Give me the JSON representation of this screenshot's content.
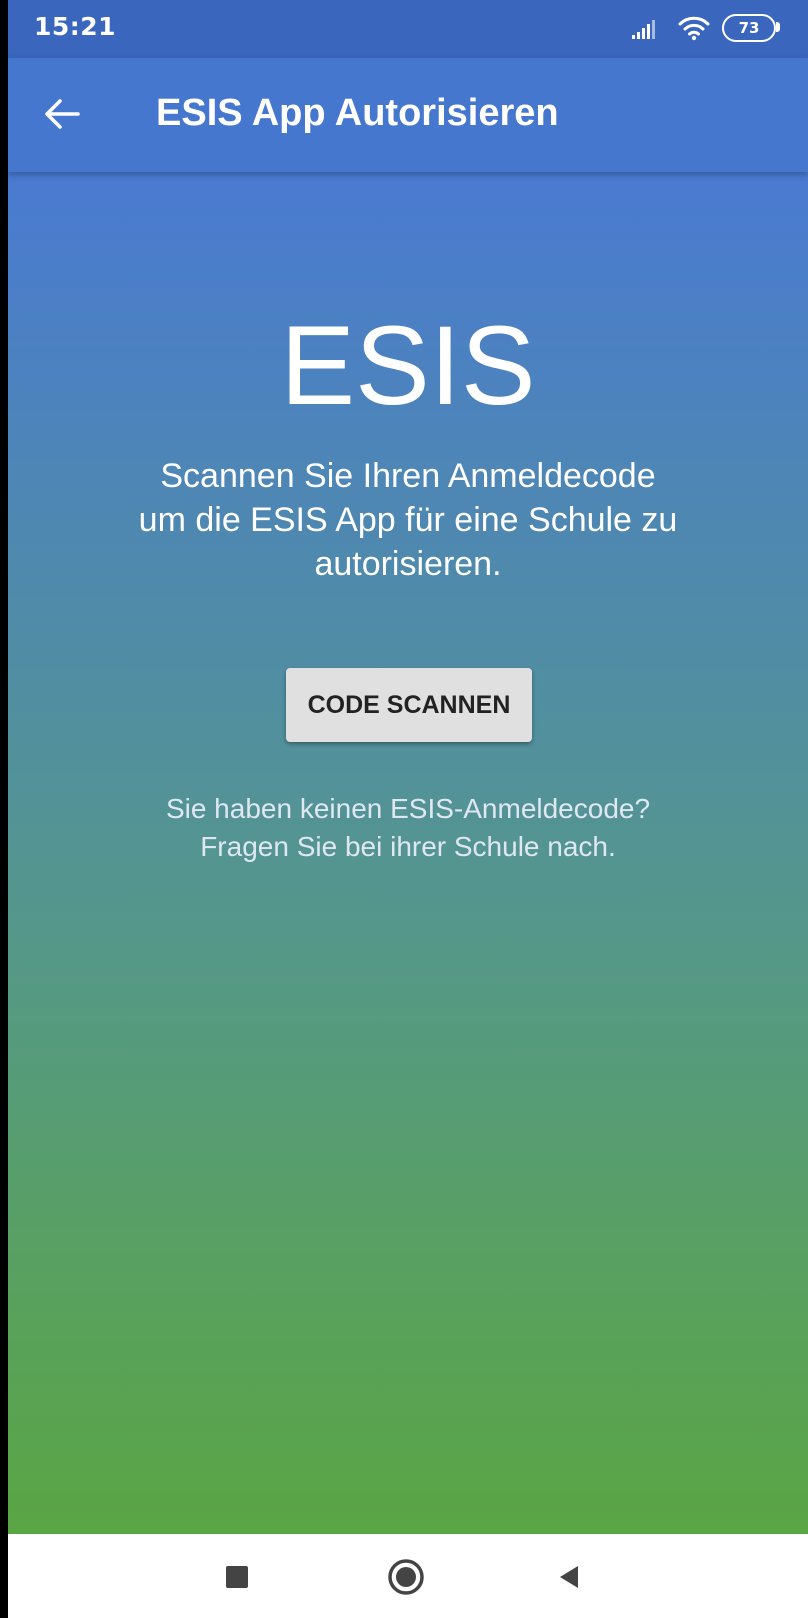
{
  "status_bar": {
    "time": "15:21",
    "battery_level": "73",
    "icons": [
      "signal-icon",
      "wifi-icon",
      "battery-icon"
    ]
  },
  "app_bar": {
    "title": "ESIS App Autorisieren",
    "back_icon": "arrow-left-icon"
  },
  "main": {
    "logo_text": "ESIS",
    "intro_line_1": "Scannen Sie Ihren Anmeldecode",
    "intro_line_2": "um die ESIS App für eine Schule zu",
    "intro_line_3": "autorisieren.",
    "scan_button_label": "CODE SCANNEN",
    "help_line_1": "Sie haben keinen ESIS-Anmeldecode?",
    "help_line_2": "Fragen Sie bei ihrer Schule nach."
  },
  "nav_bar": {
    "icons": [
      "recents-square-icon",
      "home-circle-icon",
      "back-triangle-icon"
    ]
  },
  "colors": {
    "status_bar": "#3a66be",
    "app_bar": "#4677cf",
    "gradient_top": "#4a7ad2",
    "gradient_bottom": "#5aa544",
    "button_bg": "#e0e0e0"
  }
}
